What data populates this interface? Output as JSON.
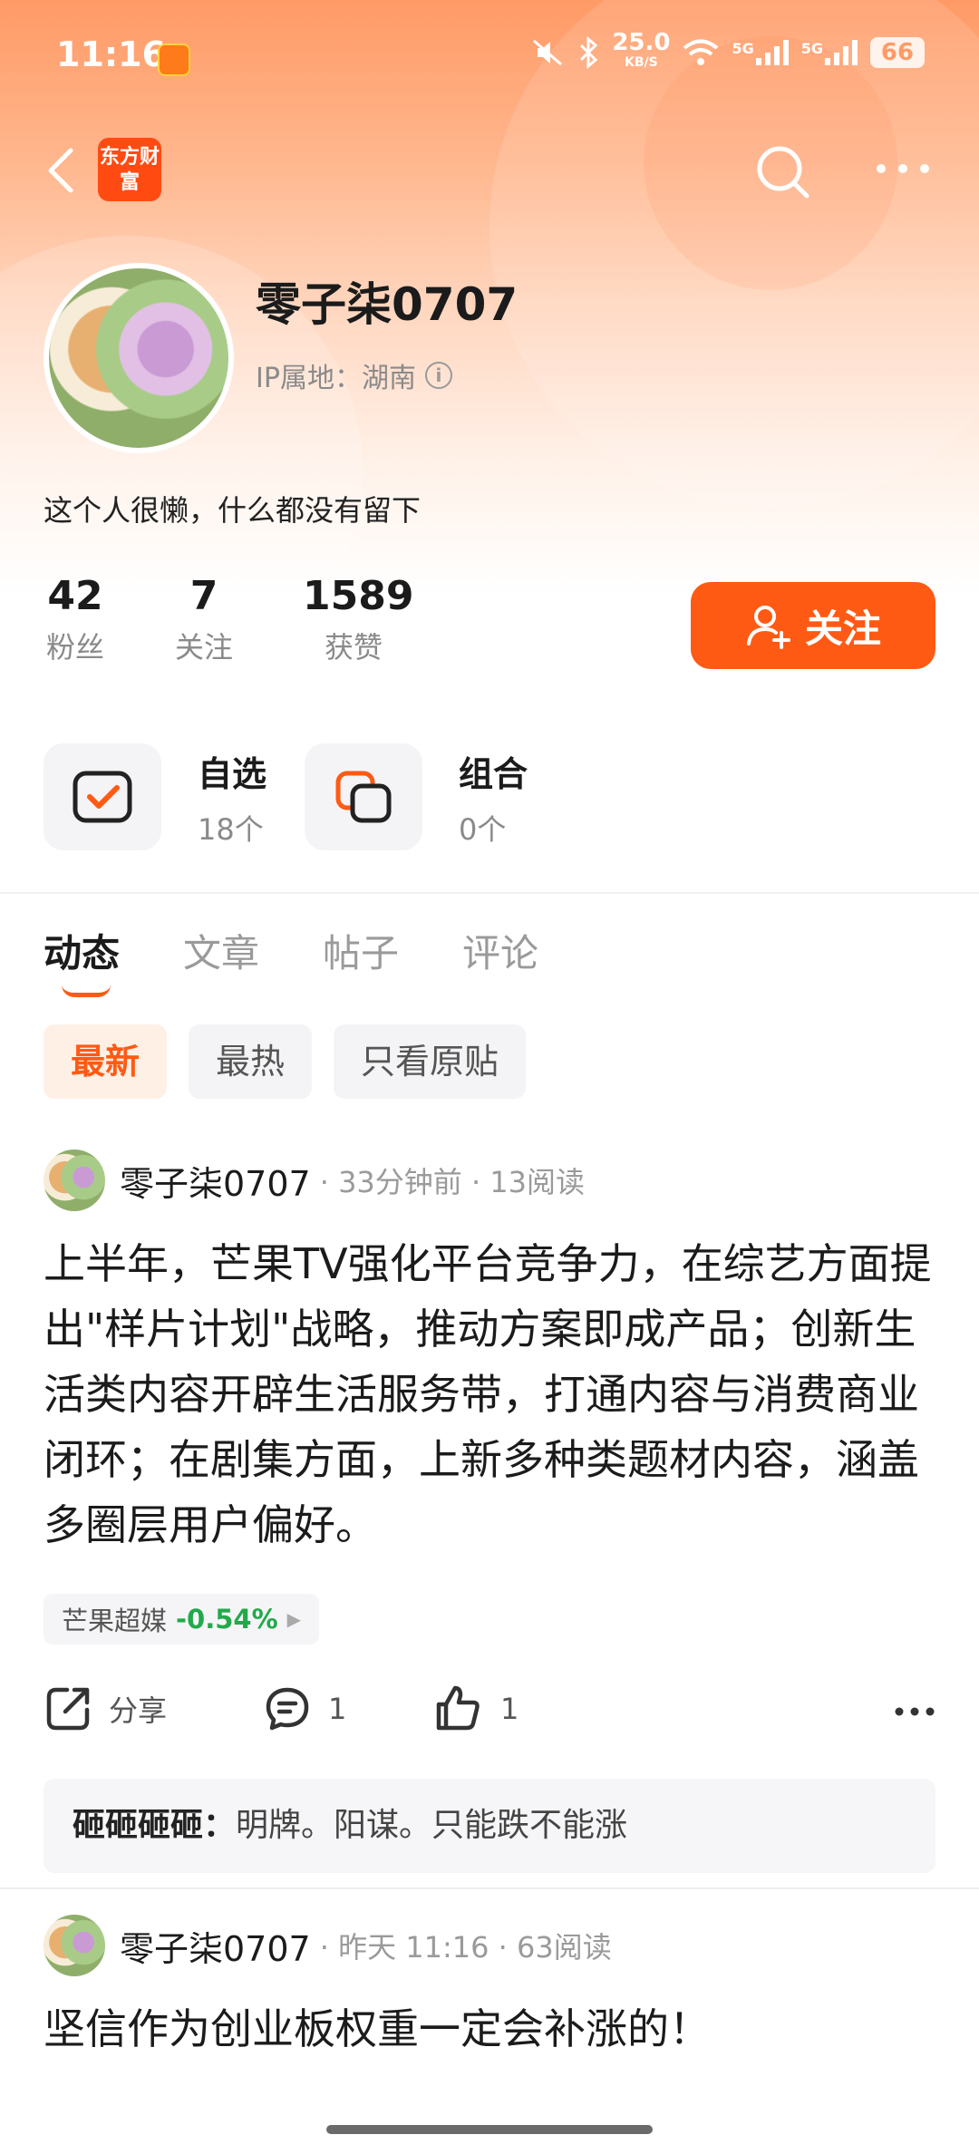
{
  "status_bar": {
    "time": "11:16",
    "net_speed": "25.0",
    "net_unit": "KB/S",
    "signal_1": "5G",
    "signal_2": "5G",
    "battery": "66"
  },
  "brand": {
    "logo_text": "东方财富"
  },
  "profile": {
    "username": "零子柒0707",
    "ip_location": "IP属地：湖南",
    "bio": "这个人很懒，什么都没有留下",
    "stats": {
      "fans": {
        "value": "42",
        "label": "粉丝"
      },
      "following": {
        "value": "7",
        "label": "关注"
      },
      "likes": {
        "value": "1589",
        "label": "获赞"
      }
    },
    "follow_label": "关注"
  },
  "quick_entries": {
    "watchlist": {
      "title": "自选",
      "count": "18个"
    },
    "portfolio": {
      "title": "组合",
      "count": "0个"
    }
  },
  "tabs": [
    "动态",
    "文章",
    "帖子",
    "评论"
  ],
  "active_tab": "动态",
  "filters": [
    "最新",
    "最热",
    "只看原贴"
  ],
  "active_filter": "最新",
  "posts": [
    {
      "author": "零子柒0707",
      "meta": "· 33分钟前 · 13阅读",
      "body": "上半年，芒果TV强化平台竞争力，在综艺方面提出\"样片计划\"战略，推动方案即成产品；创新生活类内容开辟生活服务带，打通内容与消费商业闭环；在剧集方面，上新多种类题材内容，涵盖多圈层用户偏好。",
      "stock": {
        "name": "芒果超媒",
        "change": "-0.54%",
        "change_color": "#22a94a"
      },
      "share_label": "分享",
      "comment_count": "1",
      "like_count": "1",
      "top_comment": {
        "who": "砸砸砸砸：",
        "text": "明牌。阳谋。只能跌不能涨"
      }
    },
    {
      "author": "零子柒0707",
      "meta": "· 昨天 11:16 · 63阅读",
      "body": "坚信作为创业板权重一定会补涨的！"
    }
  ],
  "colors": {
    "accent": "#ff5a14",
    "header_top": "#ff9a66",
    "stock_down": "#22a94a"
  }
}
